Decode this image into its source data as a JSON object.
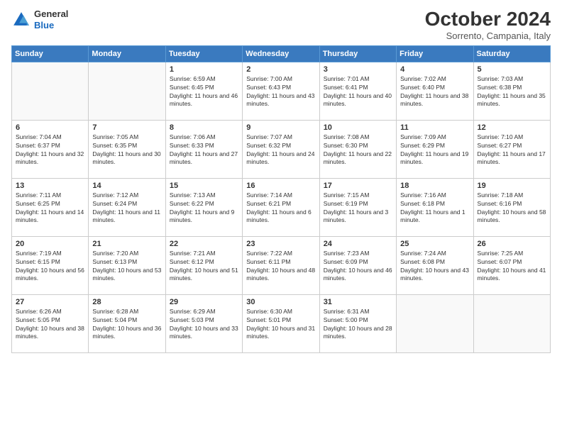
{
  "header": {
    "logo_general": "General",
    "logo_blue": "Blue",
    "title": "October 2024",
    "location": "Sorrento, Campania, Italy"
  },
  "days_of_week": [
    "Sunday",
    "Monday",
    "Tuesday",
    "Wednesday",
    "Thursday",
    "Friday",
    "Saturday"
  ],
  "weeks": [
    [
      {
        "day": "",
        "sunrise": "",
        "sunset": "",
        "daylight": ""
      },
      {
        "day": "",
        "sunrise": "",
        "sunset": "",
        "daylight": ""
      },
      {
        "day": "1",
        "sunrise": "Sunrise: 6:59 AM",
        "sunset": "Sunset: 6:45 PM",
        "daylight": "Daylight: 11 hours and 46 minutes."
      },
      {
        "day": "2",
        "sunrise": "Sunrise: 7:00 AM",
        "sunset": "Sunset: 6:43 PM",
        "daylight": "Daylight: 11 hours and 43 minutes."
      },
      {
        "day": "3",
        "sunrise": "Sunrise: 7:01 AM",
        "sunset": "Sunset: 6:41 PM",
        "daylight": "Daylight: 11 hours and 40 minutes."
      },
      {
        "day": "4",
        "sunrise": "Sunrise: 7:02 AM",
        "sunset": "Sunset: 6:40 PM",
        "daylight": "Daylight: 11 hours and 38 minutes."
      },
      {
        "day": "5",
        "sunrise": "Sunrise: 7:03 AM",
        "sunset": "Sunset: 6:38 PM",
        "daylight": "Daylight: 11 hours and 35 minutes."
      }
    ],
    [
      {
        "day": "6",
        "sunrise": "Sunrise: 7:04 AM",
        "sunset": "Sunset: 6:37 PM",
        "daylight": "Daylight: 11 hours and 32 minutes."
      },
      {
        "day": "7",
        "sunrise": "Sunrise: 7:05 AM",
        "sunset": "Sunset: 6:35 PM",
        "daylight": "Daylight: 11 hours and 30 minutes."
      },
      {
        "day": "8",
        "sunrise": "Sunrise: 7:06 AM",
        "sunset": "Sunset: 6:33 PM",
        "daylight": "Daylight: 11 hours and 27 minutes."
      },
      {
        "day": "9",
        "sunrise": "Sunrise: 7:07 AM",
        "sunset": "Sunset: 6:32 PM",
        "daylight": "Daylight: 11 hours and 24 minutes."
      },
      {
        "day": "10",
        "sunrise": "Sunrise: 7:08 AM",
        "sunset": "Sunset: 6:30 PM",
        "daylight": "Daylight: 11 hours and 22 minutes."
      },
      {
        "day": "11",
        "sunrise": "Sunrise: 7:09 AM",
        "sunset": "Sunset: 6:29 PM",
        "daylight": "Daylight: 11 hours and 19 minutes."
      },
      {
        "day": "12",
        "sunrise": "Sunrise: 7:10 AM",
        "sunset": "Sunset: 6:27 PM",
        "daylight": "Daylight: 11 hours and 17 minutes."
      }
    ],
    [
      {
        "day": "13",
        "sunrise": "Sunrise: 7:11 AM",
        "sunset": "Sunset: 6:25 PM",
        "daylight": "Daylight: 11 hours and 14 minutes."
      },
      {
        "day": "14",
        "sunrise": "Sunrise: 7:12 AM",
        "sunset": "Sunset: 6:24 PM",
        "daylight": "Daylight: 11 hours and 11 minutes."
      },
      {
        "day": "15",
        "sunrise": "Sunrise: 7:13 AM",
        "sunset": "Sunset: 6:22 PM",
        "daylight": "Daylight: 11 hours and 9 minutes."
      },
      {
        "day": "16",
        "sunrise": "Sunrise: 7:14 AM",
        "sunset": "Sunset: 6:21 PM",
        "daylight": "Daylight: 11 hours and 6 minutes."
      },
      {
        "day": "17",
        "sunrise": "Sunrise: 7:15 AM",
        "sunset": "Sunset: 6:19 PM",
        "daylight": "Daylight: 11 hours and 3 minutes."
      },
      {
        "day": "18",
        "sunrise": "Sunrise: 7:16 AM",
        "sunset": "Sunset: 6:18 PM",
        "daylight": "Daylight: 11 hours and 1 minute."
      },
      {
        "day": "19",
        "sunrise": "Sunrise: 7:18 AM",
        "sunset": "Sunset: 6:16 PM",
        "daylight": "Daylight: 10 hours and 58 minutes."
      }
    ],
    [
      {
        "day": "20",
        "sunrise": "Sunrise: 7:19 AM",
        "sunset": "Sunset: 6:15 PM",
        "daylight": "Daylight: 10 hours and 56 minutes."
      },
      {
        "day": "21",
        "sunrise": "Sunrise: 7:20 AM",
        "sunset": "Sunset: 6:13 PM",
        "daylight": "Daylight: 10 hours and 53 minutes."
      },
      {
        "day": "22",
        "sunrise": "Sunrise: 7:21 AM",
        "sunset": "Sunset: 6:12 PM",
        "daylight": "Daylight: 10 hours and 51 minutes."
      },
      {
        "day": "23",
        "sunrise": "Sunrise: 7:22 AM",
        "sunset": "Sunset: 6:11 PM",
        "daylight": "Daylight: 10 hours and 48 minutes."
      },
      {
        "day": "24",
        "sunrise": "Sunrise: 7:23 AM",
        "sunset": "Sunset: 6:09 PM",
        "daylight": "Daylight: 10 hours and 46 minutes."
      },
      {
        "day": "25",
        "sunrise": "Sunrise: 7:24 AM",
        "sunset": "Sunset: 6:08 PM",
        "daylight": "Daylight: 10 hours and 43 minutes."
      },
      {
        "day": "26",
        "sunrise": "Sunrise: 7:25 AM",
        "sunset": "Sunset: 6:07 PM",
        "daylight": "Daylight: 10 hours and 41 minutes."
      }
    ],
    [
      {
        "day": "27",
        "sunrise": "Sunrise: 6:26 AM",
        "sunset": "Sunset: 5:05 PM",
        "daylight": "Daylight: 10 hours and 38 minutes."
      },
      {
        "day": "28",
        "sunrise": "Sunrise: 6:28 AM",
        "sunset": "Sunset: 5:04 PM",
        "daylight": "Daylight: 10 hours and 36 minutes."
      },
      {
        "day": "29",
        "sunrise": "Sunrise: 6:29 AM",
        "sunset": "Sunset: 5:03 PM",
        "daylight": "Daylight: 10 hours and 33 minutes."
      },
      {
        "day": "30",
        "sunrise": "Sunrise: 6:30 AM",
        "sunset": "Sunset: 5:01 PM",
        "daylight": "Daylight: 10 hours and 31 minutes."
      },
      {
        "day": "31",
        "sunrise": "Sunrise: 6:31 AM",
        "sunset": "Sunset: 5:00 PM",
        "daylight": "Daylight: 10 hours and 28 minutes."
      },
      {
        "day": "",
        "sunrise": "",
        "sunset": "",
        "daylight": ""
      },
      {
        "day": "",
        "sunrise": "",
        "sunset": "",
        "daylight": ""
      }
    ]
  ]
}
